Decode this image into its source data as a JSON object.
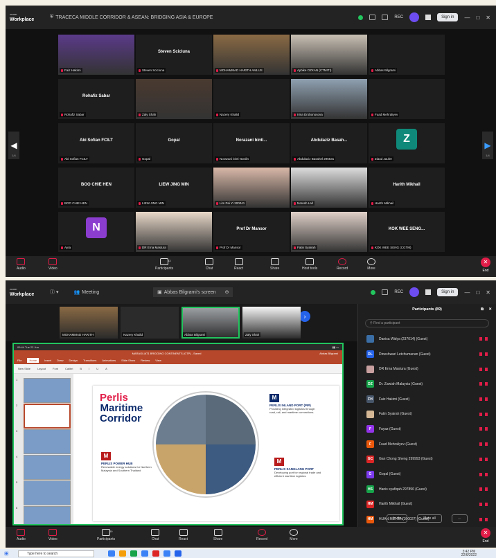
{
  "top": {
    "app_name": "Workplace",
    "app_sub": "zoom",
    "meeting_title": "TRACECA MIDDLE CORRIDOR & ASEAN: BRIDGING ASIA & EUROPE",
    "rec": "REC",
    "signin": "Sign in",
    "page_left": "1/4",
    "page_right": "1/4",
    "tiles": [
      {
        "name": "",
        "label": "Faiz Hakimi",
        "video": true,
        "color": "#5b3a8a"
      },
      {
        "name": "Steven Scicluna",
        "label": "Steven Scicluna",
        "video": false
      },
      {
        "name": "",
        "label": "MOHAMMAD HARITH AMLUS",
        "video": true,
        "color": "#8a6a44",
        "active": true
      },
      {
        "name": "",
        "label": "Aybike OZKAN (CTMITI)",
        "video": true,
        "color": "#c9c0b4"
      },
      {
        "name": "",
        "label": "Abbas Bilgrami",
        "video": false
      },
      {
        "name": "Rohafiz Sabar",
        "label": "Rohafiz Sabar",
        "video": false
      },
      {
        "name": "",
        "label": "Zaly Shah",
        "video": true,
        "color": "#4a3a30"
      },
      {
        "name": "",
        "label": "Nazery Khalid",
        "video": false
      },
      {
        "name": "",
        "label": "Irina Drobonosova",
        "video": true,
        "color": "#8fa0b0"
      },
      {
        "name": "",
        "label": "Fuad Mehraliyev",
        "video": false
      },
      {
        "name": "Abi Sofian FCILT",
        "label": "Abi Sofian FCILT",
        "video": false
      },
      {
        "name": "Gopal",
        "label": "Gopal",
        "video": false
      },
      {
        "name": "Norazani binti...",
        "label": "Norazani binti Nordin",
        "video": false
      },
      {
        "name": "Abdulaziz Basah...",
        "label": "Abdulaziz Basahel 296531",
        "video": false
      },
      {
        "name": "",
        "label": "Ziaud Jaufer",
        "video": false,
        "letter": "Z",
        "lettercolor": "#0f8a7a"
      },
      {
        "name": "BOO CHIE HEN",
        "label": "BOO CHIE HEN",
        "video": false
      },
      {
        "name": "LIEW JING MIN",
        "label": "LIEW JING MIN",
        "video": false
      },
      {
        "name": "",
        "label": "Lim Pei Yi 300041",
        "video": true,
        "color": "#d9b8a8"
      },
      {
        "name": "",
        "label": "Naresh Lall",
        "video": true,
        "color": "#ddd"
      },
      {
        "name": "Harith Mikhail",
        "label": "Harith Mikhail",
        "video": false
      },
      {
        "name": "",
        "label": "Ayra",
        "video": false,
        "letter": "N",
        "lettercolor": "#8b3dd0"
      },
      {
        "name": "",
        "label": "DR Erna Mastura",
        "video": true,
        "color": "#e8d8c8"
      },
      {
        "name": "Prof Dr Mansor",
        "label": "Prof Dr Mansor",
        "video": false
      },
      {
        "name": "",
        "label": "Fatin Syairah",
        "video": true,
        "color": "#e0d0c8"
      },
      {
        "name": "KOK WEE SENG...",
        "label": "KOK WEE SENG (CGTM)",
        "video": false
      }
    ],
    "toolbar": [
      {
        "label": "Audio",
        "red": true
      },
      {
        "label": "Video",
        "red": true
      },
      {
        "label": "Participants",
        "count": "83"
      },
      {
        "label": "Chat"
      },
      {
        "label": "React"
      },
      {
        "label": "Share"
      },
      {
        "label": "Host tools"
      },
      {
        "label": "Record",
        "red": true
      },
      {
        "label": "More"
      }
    ],
    "end": "End"
  },
  "bottom": {
    "app_name": "Workplace",
    "app_sub": "zoom",
    "meeting": "Meeting",
    "screen_tab": "Abbas Bilgrami's screen",
    "rec": "REC",
    "signin": "Sign in",
    "strip": [
      {
        "label": "MOHAMMAD HARITH",
        "color": "#8a6a44"
      },
      {
        "label": "Nazery Khalid",
        "color": "#2b2b2b"
      },
      {
        "label": "Abbas Bilgrami",
        "color": "#a0a4a8",
        "active": true
      },
      {
        "label": "Zaly Shah",
        "color": "#f5f5f5"
      }
    ],
    "ppt": {
      "time": "09:44  Tue 22 Jun",
      "doc_title": "MARAGLIAT1 BRIDGING CONTINENTS (GTP) - Saved",
      "user": "Abbas Bilgrami",
      "tabs": [
        "File",
        "Home",
        "Insert",
        "Draw",
        "Design",
        "Transitions",
        "Animations",
        "Slide Show",
        "Review",
        "View"
      ],
      "ribbon": [
        "New Slide",
        "Layout",
        "Font",
        "Calibri",
        "B",
        "I",
        "U",
        "A"
      ],
      "title1": "Perlis",
      "title2": "Maritime",
      "title3": "Corridor",
      "ports": [
        {
          "head": "PERLIS INLAND PORT (PIP)",
          "text": "Providing integrated logistics through road, rail, and maritime connections."
        },
        {
          "head": "PERLIS POWER HUB",
          "text": "Renewable energy solutions for Northern Malaysia and Southern Thailand"
        },
        {
          "head": "PERLIS SANGLANG PORT",
          "text": "Developing port for regional trade and efficient maritime logistics"
        }
      ],
      "thumb_numbers": [
        "1",
        "2",
        "3",
        "4",
        "5",
        "6"
      ]
    },
    "panel": {
      "title": "Participants (89)",
      "search": "Find a participant",
      "rows": [
        {
          "name": "Danisa Widya (237014) (Guest)",
          "av": "img",
          "color": "#3a6ea5"
        },
        {
          "name": "Dineshwari Letchumanan (Guest)",
          "av": "DL",
          "color": "#2563eb"
        },
        {
          "name": "DR Erna Mastura (Guest)",
          "av": "img",
          "color": "#c9a0a0"
        },
        {
          "name": "Dr. Zawiah Malaysia (Guest)",
          "av": "DZ",
          "color": "#16a34a"
        },
        {
          "name": "Faiz Hakimi (Guest)",
          "av": "FH",
          "color": "#475569"
        },
        {
          "name": "Fatin Syairah (Guest)",
          "av": "img",
          "color": "#d4b896"
        },
        {
          "name": "Fayaz (Guest)",
          "av": "F",
          "color": "#9333ea"
        },
        {
          "name": "Fuad Mehraliyev (Guest)",
          "av": "F",
          "color": "#ea580c"
        },
        {
          "name": "Gan Chong Sheng 299993 (Guest)",
          "av": "GC",
          "color": "#dc2626"
        },
        {
          "name": "Gopal (Guest)",
          "av": "G",
          "color": "#7c3aed"
        },
        {
          "name": "Hanis syafiqah 297896 (Guest)",
          "av": "HS",
          "color": "#16a34a"
        },
        {
          "name": "Harith Mikhail (Guest)",
          "av": "HM",
          "color": "#dc2626"
        },
        {
          "name": "HUAN MEI XIN(300027) (Guest)",
          "av": "HM",
          "color": "#ea580c"
        }
      ],
      "invite": "Invite",
      "mute_all": "Mute all"
    },
    "toolbar": [
      {
        "label": "Audio",
        "red": true
      },
      {
        "label": "Video",
        "red": true
      },
      {
        "label": "Participants",
        "count": "89"
      },
      {
        "label": "Chat"
      },
      {
        "label": "React"
      },
      {
        "label": "Share"
      },
      {
        "label": "Record",
        "red": true
      },
      {
        "label": "More"
      }
    ],
    "end": "End"
  },
  "taskbar": {
    "search": "Type here to search",
    "time": "3:42 PM",
    "date": "22/6/2022"
  }
}
